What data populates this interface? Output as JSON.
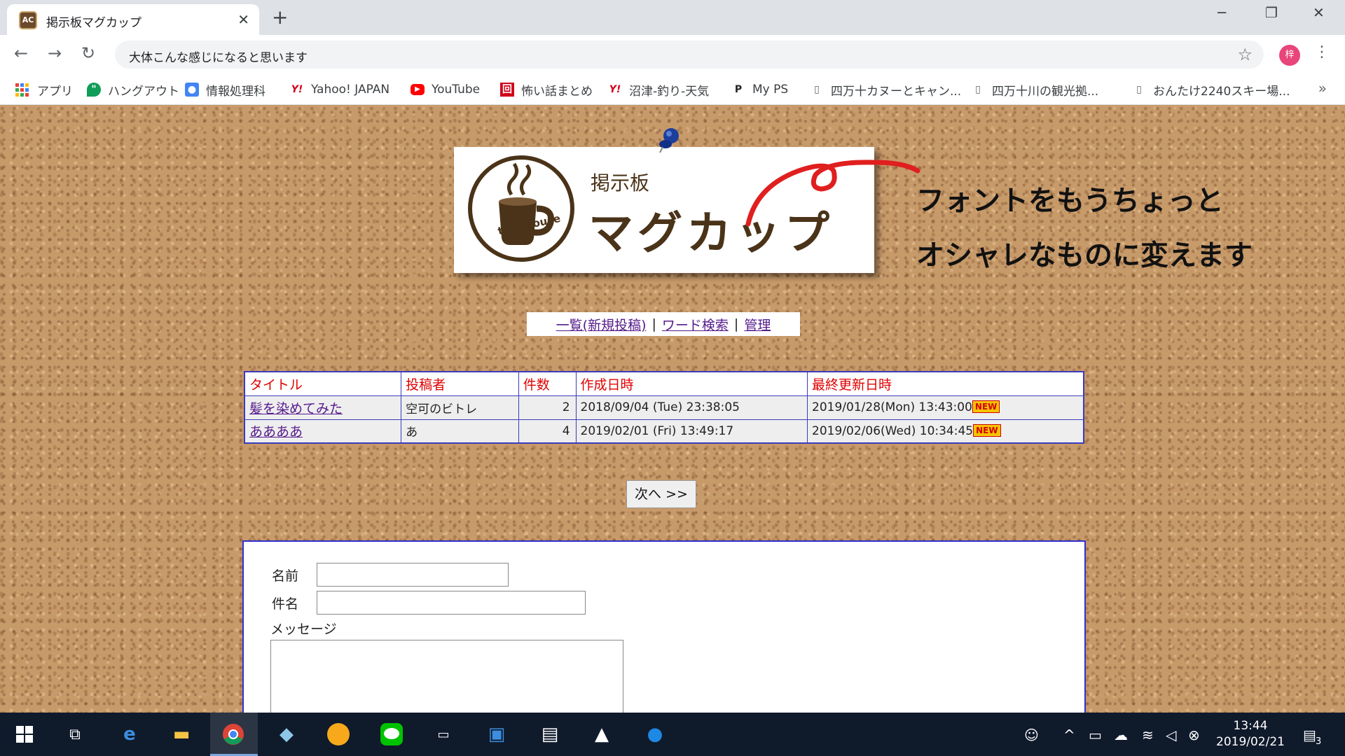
{
  "browser": {
    "tab_title": "掲示板マグカップ",
    "tab_favicon_text": "AC",
    "new_tab_symbol": "+",
    "close_symbol": "✕",
    "address": "大体こんな感じになると思います",
    "profile_initial": "梓",
    "bookmarks": [
      {
        "label": "アプリ",
        "icon": "apps-grid-icon"
      },
      {
        "label": "ハングアウト",
        "icon": "hangouts-icon"
      },
      {
        "label": "情報処理科",
        "icon": "contact-card-icon"
      },
      {
        "label": "Yahoo! JAPAN",
        "icon": "yahoo-icon"
      },
      {
        "label": "YouTube",
        "icon": "youtube-icon"
      },
      {
        "label": "怖い話まとめ",
        "icon": "red-square-icon"
      },
      {
        "label": "沼津-釣り-天気",
        "icon": "yahoo-icon"
      },
      {
        "label": "My PS",
        "icon": "playstation-icon"
      },
      {
        "label": "四万十カヌーとキャン...",
        "icon": "document-icon"
      },
      {
        "label": "四万十川の観光拠...",
        "icon": "document-icon"
      },
      {
        "label": "おんたけ2240スキー場...",
        "icon": "document-icon"
      }
    ],
    "bookmarks_more": "»"
  },
  "page": {
    "logo_small": "掲示板",
    "logo_big": "マグカップ",
    "logo_emblem_text": "tera house",
    "annotation_lines": [
      "フォントをもうちょっと",
      "オシャレなものに変えます"
    ],
    "nav": {
      "link1": "一覧(新規投稿)",
      "link2": "ワード検索",
      "link3": "管理",
      "separator": "|"
    },
    "table": {
      "headers": [
        "タイトル",
        "投稿者",
        "件数",
        "作成日時",
        "最終更新日時"
      ],
      "rows": [
        {
          "title": "髪を染めてみた",
          "author": "空可のビトレ",
          "count": "2",
          "created": "2018/09/04 (Tue) 23:38:05",
          "updated": "2019/01/28(Mon) 13:43:00",
          "badge": "NEW"
        },
        {
          "title": "ああああ",
          "author": "あ",
          "count": "4",
          "created": "2019/02/01 (Fri) 13:49:17",
          "updated": "2019/02/06(Wed) 10:34:45",
          "badge": "NEW"
        }
      ]
    },
    "next_button": "次へ >>",
    "form": {
      "name_label": "名前",
      "subject_label": "件名",
      "message_label": "メッセージ",
      "name_value": "",
      "subject_value": "",
      "message_value": ""
    }
  },
  "taskbar": {
    "time": "13:44",
    "date": "2019/02/21",
    "notification_count": "3"
  },
  "colors": {
    "table_border": "#3b3bbd",
    "header_text": "#e00000",
    "link": "#551a8b",
    "cork": "#c79a6a",
    "logo_brown": "#4a3318"
  }
}
